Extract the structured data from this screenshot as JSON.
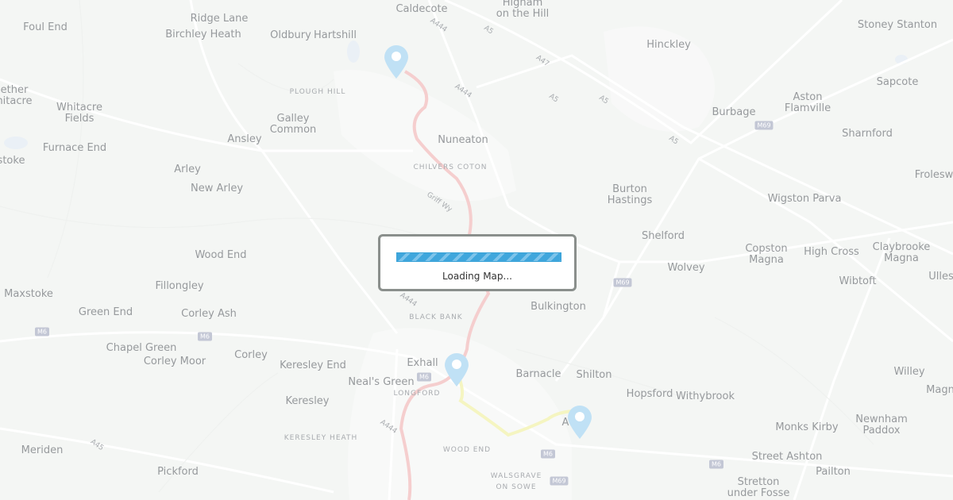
{
  "loading": {
    "text": "Loading Map...",
    "progress": 1.0
  },
  "places": [
    {
      "name": "Caldecote"
    },
    {
      "name": "Higham\non the Hill"
    },
    {
      "name": "Foul End"
    },
    {
      "name": "Ridge Lane"
    },
    {
      "name": "Birchley Heath"
    },
    {
      "name": "Oldbury"
    },
    {
      "name": "Hartshill"
    },
    {
      "name": "Hinckley"
    },
    {
      "name": "Stoney Stanton"
    },
    {
      "name": "Sapcote"
    },
    {
      "name": "Aston\nFlamville"
    },
    {
      "name": "Burbage"
    },
    {
      "name": "Sharnford"
    },
    {
      "name": "Froleswo"
    },
    {
      "name": "ether\nhitacre"
    },
    {
      "name": "Whitacre\nFields"
    },
    {
      "name": "Galley\nCommon"
    },
    {
      "name": "Ansley"
    },
    {
      "name": "Nuneaton"
    },
    {
      "name": "Furnace End"
    },
    {
      "name": "stoke"
    },
    {
      "name": "Arley"
    },
    {
      "name": "New Arley"
    },
    {
      "name": "Burton\nHastings"
    },
    {
      "name": "Wigston Parva"
    },
    {
      "name": "Shelford"
    },
    {
      "name": "Copston\nMagna"
    },
    {
      "name": "High Cross"
    },
    {
      "name": "Claybrooke\nMagna"
    },
    {
      "name": "Wood End"
    },
    {
      "name": "Wolvey"
    },
    {
      "name": "Wibtoft"
    },
    {
      "name": "Ulles"
    },
    {
      "name": "Fillongley"
    },
    {
      "name": "Maxstoke"
    },
    {
      "name": "Bulkington"
    },
    {
      "name": "Green End"
    },
    {
      "name": "Corley Ash"
    },
    {
      "name": "Chapel Green"
    },
    {
      "name": "Corley"
    },
    {
      "name": "Corley Moor"
    },
    {
      "name": "Keresley End"
    },
    {
      "name": "Exhall"
    },
    {
      "name": "Barnacle"
    },
    {
      "name": "Shilton"
    },
    {
      "name": "Willey"
    },
    {
      "name": "Neal's Green"
    },
    {
      "name": "Hopsford"
    },
    {
      "name": "Withybrook"
    },
    {
      "name": "Magn"
    },
    {
      "name": "Keresley"
    },
    {
      "name": "Newnham\nPaddox"
    },
    {
      "name": "Monks Kirby"
    },
    {
      "name": "Meriden"
    },
    {
      "name": "Street Ashton"
    },
    {
      "name": "Pailton"
    },
    {
      "name": "Pickford"
    },
    {
      "name": "Stretton\nunder Fosse"
    },
    {
      "name": "A"
    }
  ],
  "districts": [
    "PLOUGH HILL",
    "CHILVERS COTON",
    "BLACK BANK",
    "LONGFORD",
    "KERESLEY HEATH",
    "WOOD END",
    "WALSGRAVE\nON SOWE"
  ],
  "roads": [
    "A444",
    "A5",
    "A47",
    "A5",
    "A5",
    "A5",
    "A444",
    "Griff Wy",
    "A444",
    "A444",
    "A45"
  ],
  "shields": [
    "M69",
    "M69",
    "M6",
    "M6",
    "M6",
    "M6",
    "M69",
    "M6"
  ],
  "markers": [
    {
      "name": "pin-start",
      "icon": "map-pin-icon"
    },
    {
      "name": "pin-middle",
      "icon": "map-pin-icon"
    },
    {
      "name": "pin-end",
      "icon": "map-pin-icon"
    }
  ],
  "colors": {
    "route_red": "#f0b4b4",
    "route_yellow": "#f0f0a0",
    "pin": "#9fd1f0",
    "progress": "#3fa6dc"
  }
}
